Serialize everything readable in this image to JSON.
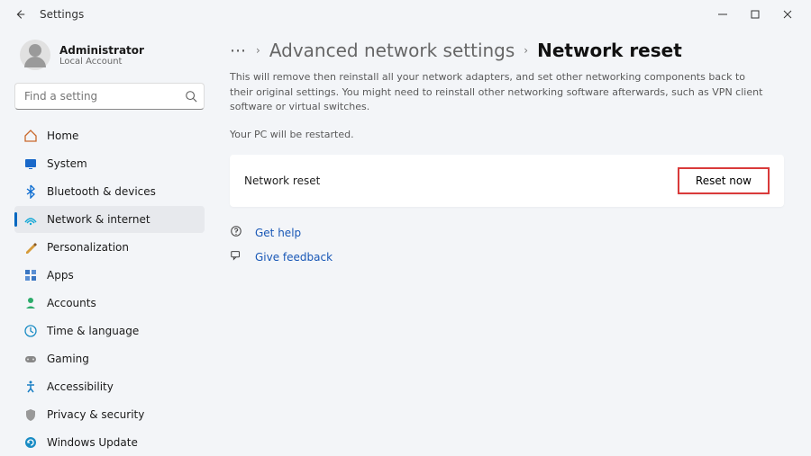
{
  "titlebar": {
    "title": "Settings"
  },
  "profile": {
    "name": "Administrator",
    "sub": "Local Account"
  },
  "search": {
    "placeholder": "Find a setting"
  },
  "nav": {
    "items": [
      {
        "label": "Home"
      },
      {
        "label": "System"
      },
      {
        "label": "Bluetooth & devices"
      },
      {
        "label": "Network & internet"
      },
      {
        "label": "Personalization"
      },
      {
        "label": "Apps"
      },
      {
        "label": "Accounts"
      },
      {
        "label": "Time & language"
      },
      {
        "label": "Gaming"
      },
      {
        "label": "Accessibility"
      },
      {
        "label": "Privacy & security"
      },
      {
        "label": "Windows Update"
      }
    ]
  },
  "breadcrumb": {
    "parent": "Advanced network settings",
    "current": "Network reset"
  },
  "description": {
    "line1": "This will remove then reinstall all your network adapters, and set other networking components back to their original settings. You might need to reinstall other networking software afterwards, such as VPN client software or virtual switches.",
    "line2": "Your PC will be restarted."
  },
  "card": {
    "label": "Network reset",
    "button": "Reset now"
  },
  "help": {
    "getHelp": "Get help",
    "feedback": "Give feedback"
  }
}
